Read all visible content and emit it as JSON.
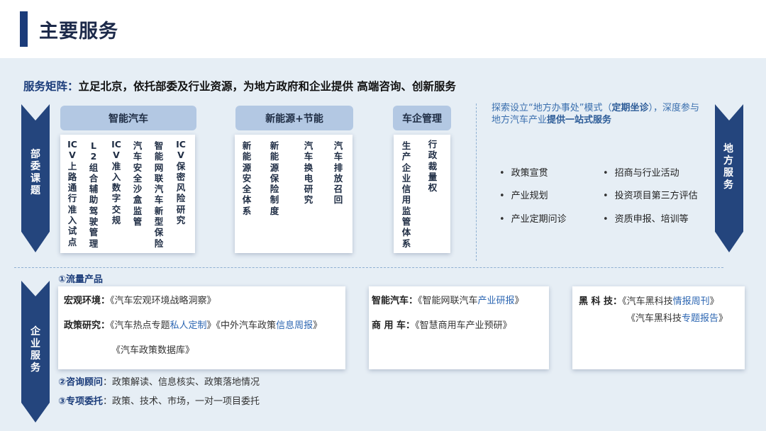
{
  "title": "主要服务",
  "headline": {
    "lead": "服务矩阵：",
    "text": "立足北京，依托部委及行业资源，为地方政府和企业提供  高端咨询、创新服务"
  },
  "left_chevrons": {
    "ministry": "部委课题",
    "enterprise": "企业服务"
  },
  "right_chevron": "地方服务",
  "categories": {
    "smart": {
      "label": "智能汽车",
      "columns": [
        "ICV上路通行准入试点",
        "L2组合辅助驾驶管理",
        "ICV准入数字交规",
        "汽车安全沙盒监管",
        "智能网联汽车新型保险",
        "ICV保密风险研究"
      ]
    },
    "nev": {
      "label": "新能源+节能",
      "columns": [
        "新能源安全体系",
        "新能源保险制度",
        "汽车换电研究",
        "汽车排放召回"
      ]
    },
    "mgmt": {
      "label": "车企管理",
      "columns": [
        "生产企业信用监管体系",
        "行政裁量权"
      ]
    }
  },
  "local": {
    "desc_pre": "探索设立“地方办事处”模式（",
    "desc_emph1": "定期坐诊",
    "desc_mid": "），深度参与地方汽车产业",
    "desc_emph2": "提供一站式服务",
    "bullets_left": [
      "政策宣贯",
      "产业规划",
      "产业定期问诊"
    ],
    "bullets_right": [
      "招商与行业活动",
      "投资项目第三方评估",
      "资质申报、培训等"
    ]
  },
  "enterprise": {
    "traffic_title": "①流量产品",
    "card1": {
      "macro_label": "宏观环境：",
      "macro_text": "《汽车宏观环境战略洞察》",
      "policy_label": "政策研究：",
      "policy_p1": "《汽车热点专题",
      "policy_h1": "私人定制",
      "policy_p2": "》《中外汽车政策",
      "policy_h2": "信息周报",
      "policy_p3": "》",
      "db_text": "《汽车政策数据库》"
    },
    "card2": {
      "smart_label": "智能汽车：",
      "smart_p1": "《智能网联汽车",
      "smart_h1": "产业研报",
      "smart_p2": "》",
      "com_label": "商 用 车：",
      "com_text": "《智慧商用车产业预研》"
    },
    "card3": {
      "tech_label": "黑 科 技：",
      "tech_p1": "《汽车黑科技",
      "tech_h1": "情报周刊",
      "tech_p2": "》",
      "tech2_p1": "《汽车黑科技",
      "tech2_h1": "专题报告",
      "tech2_p2": "》"
    },
    "consult_title": "②咨询顾问",
    "consult_text": "：政策解读、信息核实、政策落地情况",
    "special_title": "③专项委托",
    "special_text": "：政策、技术、市场，一对一项目委托"
  }
}
